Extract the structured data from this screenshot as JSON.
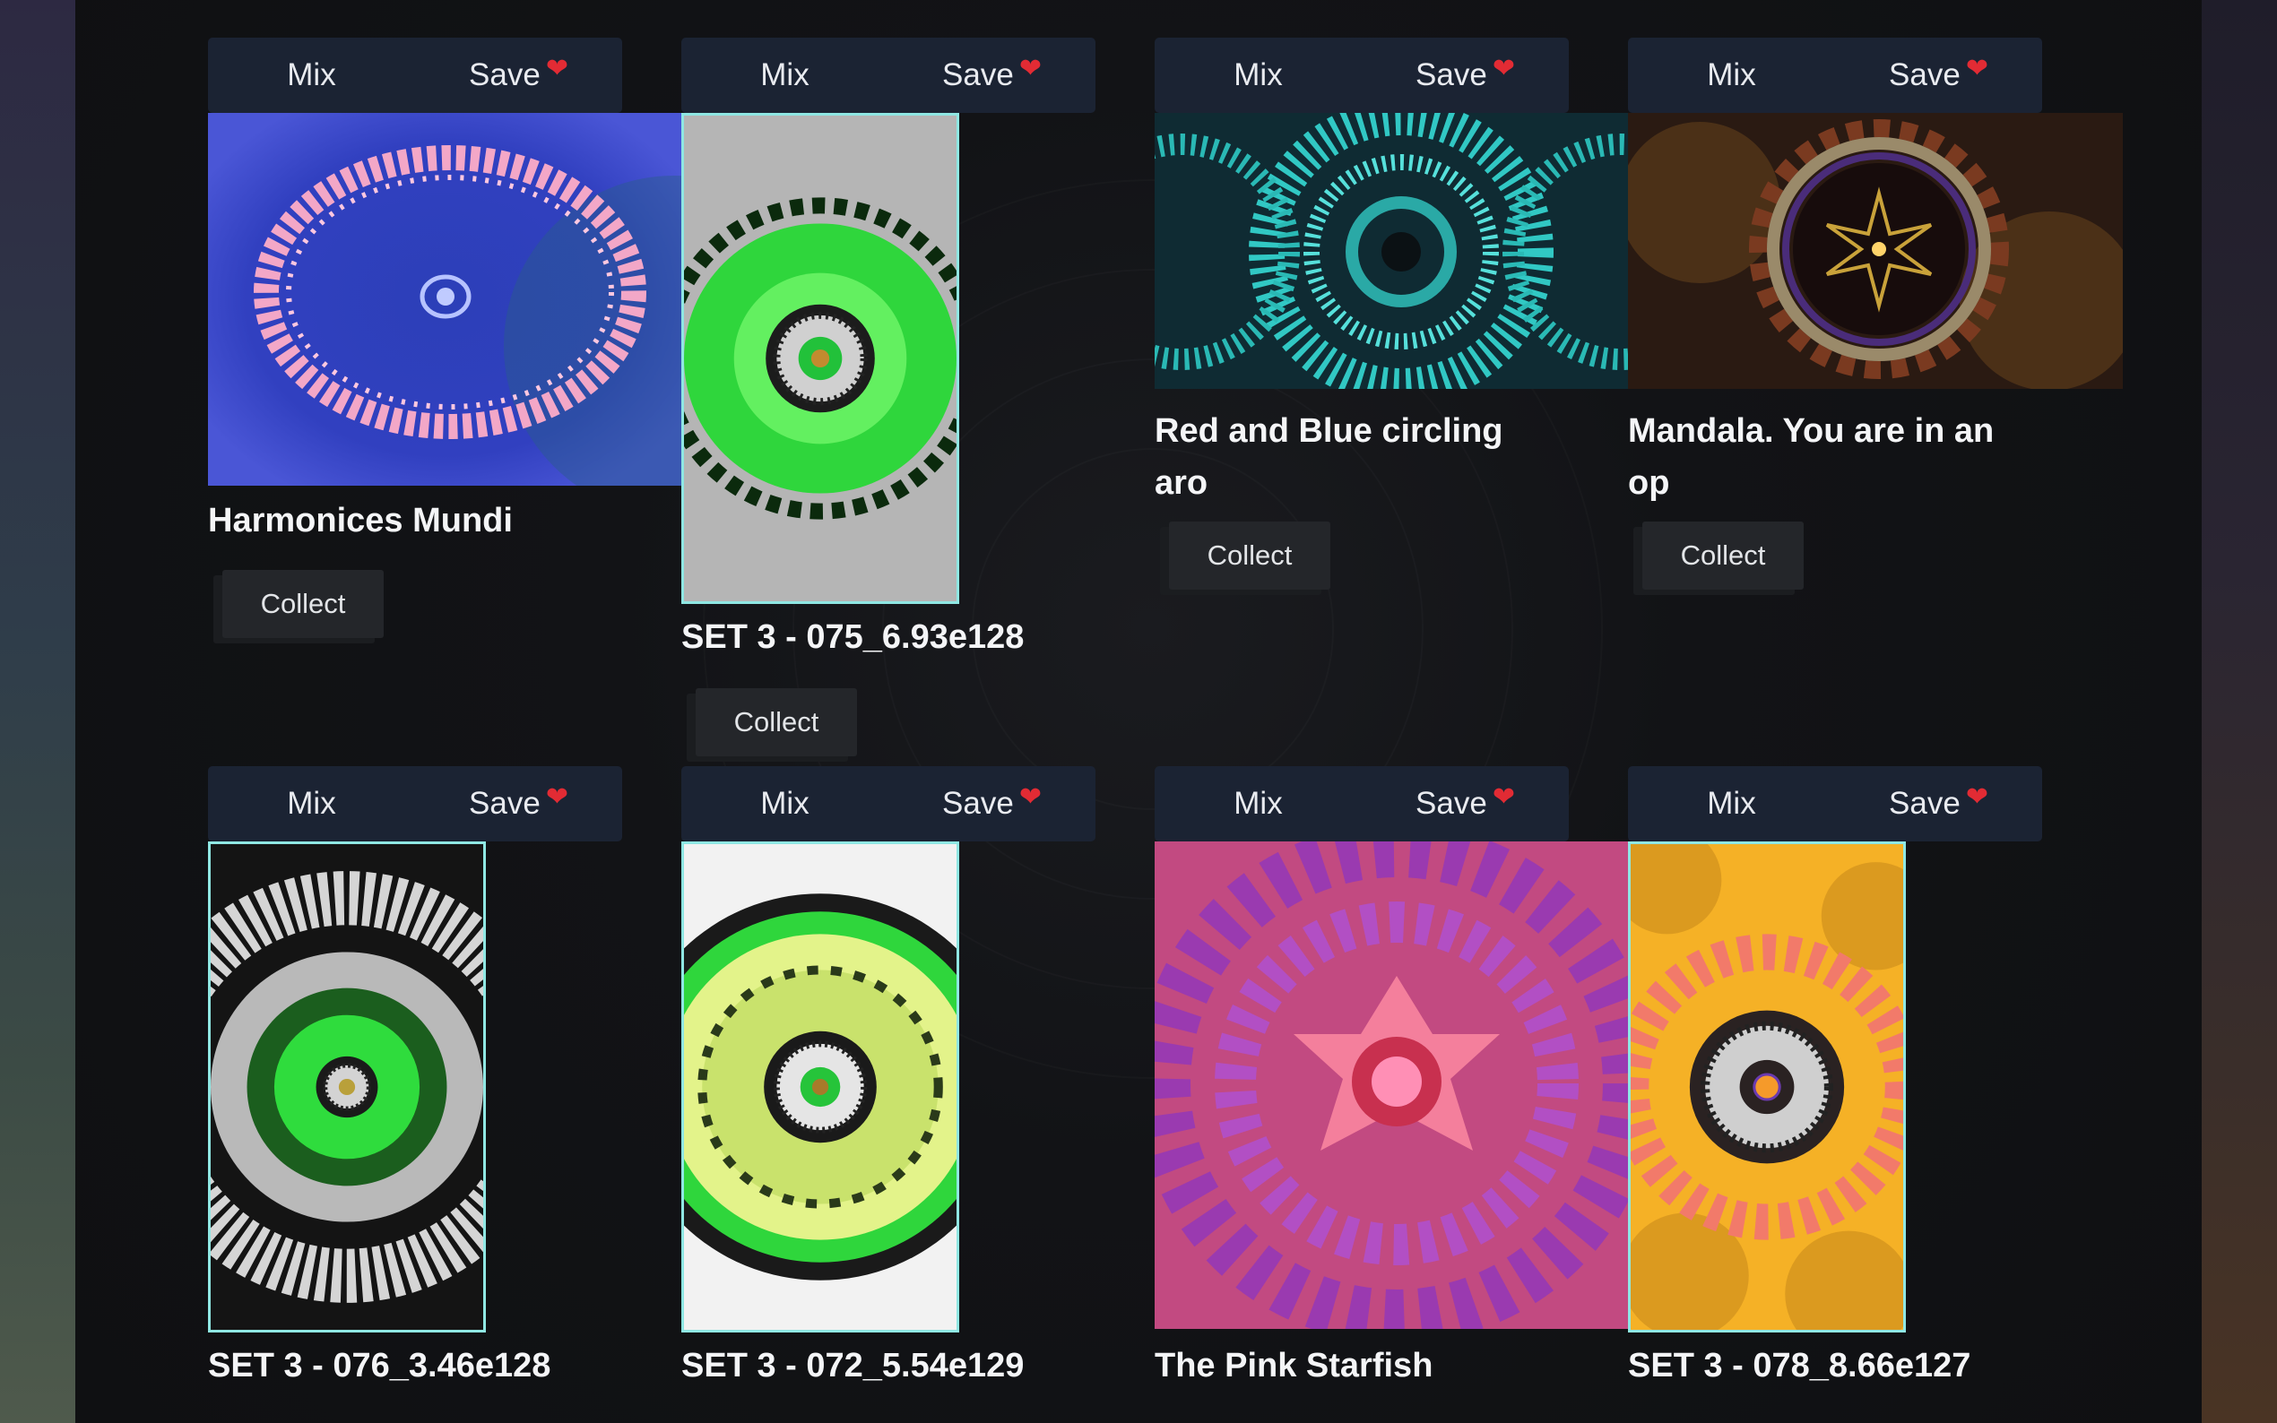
{
  "labels": {
    "mix": "Mix",
    "save": "Save",
    "heart": "❤",
    "collect": "Collect"
  },
  "cards": [
    {
      "title": "Harmonices Mundi"
    },
    {
      "title": "SET 3 - 075_6.93e128"
    },
    {
      "title": "Red and Blue circling aro"
    },
    {
      "title": "Mandala. You are in an op"
    },
    {
      "title": "SET 3 - 076_3.46e128"
    },
    {
      "title": "SET 3 - 072_5.54e129"
    },
    {
      "title": "The Pink Starfish"
    },
    {
      "title": "SET 3 - 078_8.66e127"
    }
  ],
  "colors": {
    "toolbar_bg": "#1b2333",
    "heart": "#e22b34",
    "art_border": "#8fe7e3",
    "page_bg": "#101113"
  }
}
